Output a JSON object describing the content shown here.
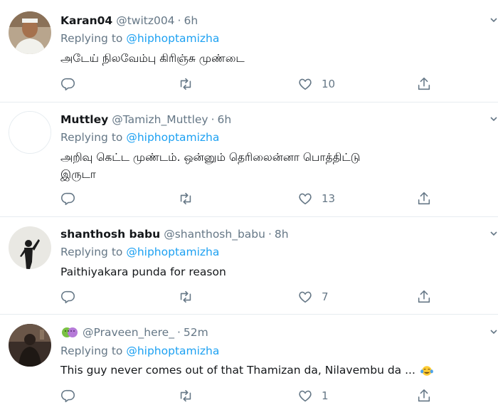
{
  "colors": {
    "link": "#1da1f2",
    "muted": "#657786",
    "text": "#14171a",
    "divider": "#e6ecf0"
  },
  "tweets": [
    {
      "name": "Karan04",
      "handle": "@twitz004",
      "separator": "·",
      "time": "6h",
      "replying_prefix": "Replying to",
      "replying_to": "@hiphoptamizha",
      "text": "அடேய் நிலவேம்பு கிரிஞ்சு முண்டை",
      "likes": "10",
      "avatar_icon": "user-photo-avatar"
    },
    {
      "name": "Muttley",
      "handle": "@Tamizh_Muttley",
      "separator": "·",
      "time": "6h",
      "replying_prefix": "Replying to",
      "replying_to": "@hiphoptamizha",
      "text_line1": "அறிவு கெட்ட முண்டம். ஒன்னும் தெரிலைன்னா பொத்திட்டு",
      "text_line2": "இருடா",
      "likes": "13",
      "avatar_icon": "default-blank-avatar"
    },
    {
      "name": "shanthosh babu",
      "handle": "@shanthosh_babu",
      "separator": "·",
      "time": "8h",
      "replying_prefix": "Replying to",
      "replying_to": "@hiphoptamizha",
      "text": "Paithiyakara punda for reason",
      "likes": "7",
      "avatar_icon": "silhouette-avatar"
    },
    {
      "name": "",
      "handle": "@Praveen_here_",
      "separator": "·",
      "time": "52m",
      "replying_prefix": "Replying to",
      "replying_to": "@hiphoptamizha",
      "text": "This guy never comes out of that Thamizan da,  Nilavembu da ...",
      "likes": "1",
      "avatar_icon": "dark-photo-avatar",
      "name_icon": "theater-masks-emoji",
      "text_icon": "tears-of-joy-emoji"
    }
  ]
}
